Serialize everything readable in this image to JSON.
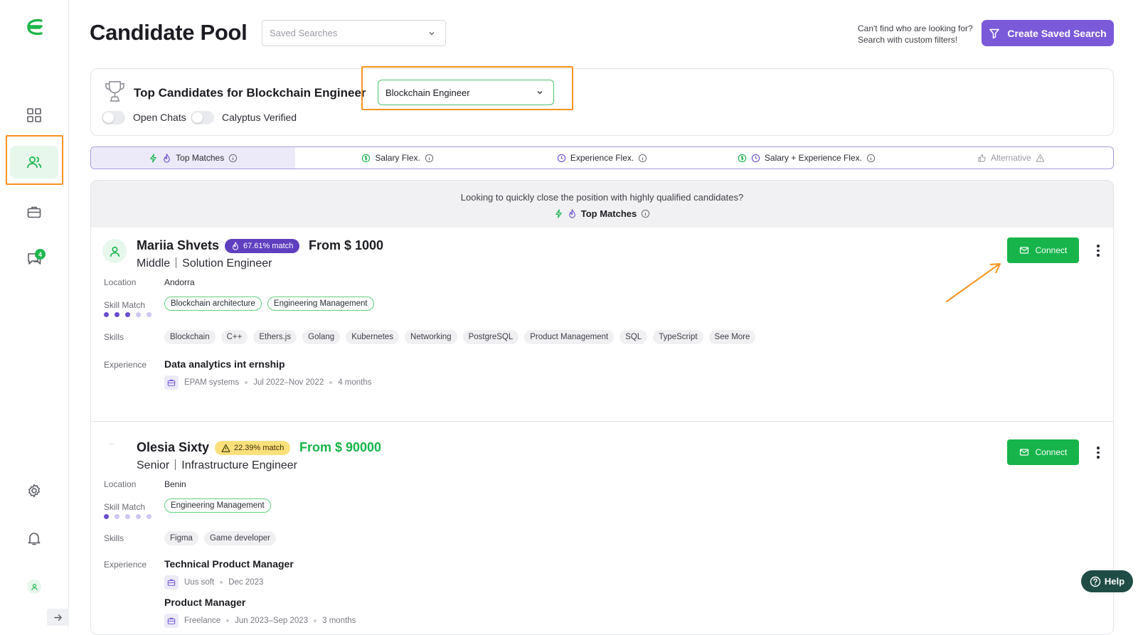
{
  "page": {
    "title": "Candidate Pool"
  },
  "saved_searches": {
    "placeholder": "Saved Searches"
  },
  "hint": {
    "line1": "Can't find who are looking for?",
    "line2": "Search with custom filters!"
  },
  "create_button": {
    "label": "Create Saved Search"
  },
  "sidebar": {
    "chat_badge": "4"
  },
  "top_panel": {
    "title": "Top Candidates for Blockchain Engineer",
    "role_select": "Blockchain Engineer",
    "toggle_open_chats": "Open Chats",
    "toggle_verified": "Calyptus Verified"
  },
  "tabs": [
    {
      "label": "Top Matches"
    },
    {
      "label": "Salary Flex."
    },
    {
      "label": "Experience Flex."
    },
    {
      "label": "Salary + Experience Flex."
    },
    {
      "label": "Alternative"
    }
  ],
  "results_header": {
    "question": "Looking to quickly close the position with highly qualified candidates?",
    "tag": "Top Matches"
  },
  "labels": {
    "location": "Location",
    "skill_match": "Skill Match",
    "skills": "Skills",
    "experience": "Experience",
    "connect": "Connect"
  },
  "candidates": [
    {
      "name": "Mariia Shvets",
      "match": "67.61% match",
      "salary": "From $ 1000",
      "level": "Middle",
      "role": "Solution Engineer",
      "location": "Andorra",
      "skill_match": [
        "Blockchain architecture",
        "Engineering Management"
      ],
      "skill_match_level": 3,
      "skills": [
        "Blockchain",
        "C++",
        "Ethers.js",
        "Golang",
        "Kubernetes",
        "Networking",
        "PostgreSQL",
        "Product Management",
        "SQL",
        "TypeScript",
        "See More"
      ],
      "experience": [
        {
          "title": "Data analytics int ernship",
          "company": "EPAM systems",
          "period": "Jul 2022–Nov 2022",
          "duration": "4 months"
        }
      ]
    },
    {
      "name": "Olesia Sixty",
      "match": "22.39% match",
      "salary": "From $ 90000",
      "level": "Senior",
      "role": "Infrastructure Engineer",
      "location": "Benin",
      "skill_match": [
        "Engineering Management"
      ],
      "skill_match_level": 1,
      "skills": [
        "Figma",
        "Game developer"
      ],
      "experience": [
        {
          "title": "Technical Product Manager",
          "company": "Uus soft",
          "period": "Dec 2023",
          "duration": ""
        },
        {
          "title": "Product Manager",
          "company": "Freelance",
          "period": "Jun 2023–Sep 2023",
          "duration": "3 months"
        }
      ]
    }
  ],
  "help": {
    "label": "Help"
  },
  "colors": {
    "brand_green": "#16b44a",
    "brand_purple": "#7a5ad9",
    "highlight_orange": "#f7931e"
  }
}
